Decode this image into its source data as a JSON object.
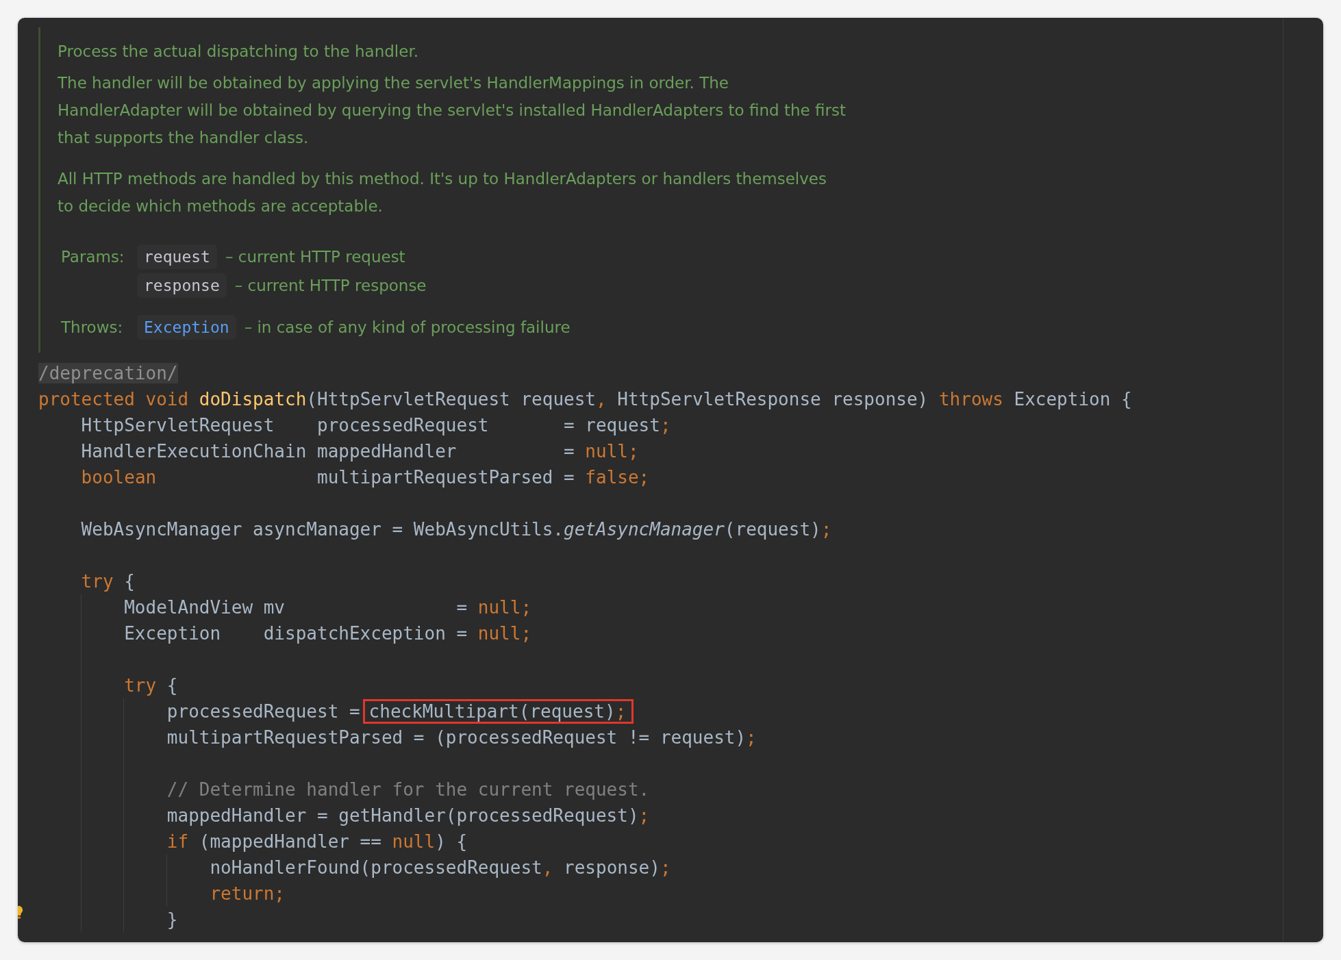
{
  "doc": {
    "paragraphs": [
      {
        "lines": [
          "Process the actual dispatching to the handler."
        ]
      },
      {
        "lines": [
          "The handler will be obtained by applying the servlet's HandlerMappings in order. The",
          "HandlerAdapter will be obtained by querying the servlet's installed HandlerAdapters to find the first",
          "that supports the handler class."
        ]
      },
      {
        "lines": [
          "All HTTP methods are handled by this method. It's up to HandlerAdapters or handlers themselves",
          "to decide which methods are acceptable."
        ]
      }
    ],
    "tags": [
      {
        "label": "Params:",
        "items": [
          {
            "name": "request",
            "description": "– current HTTP request",
            "kind": "param"
          },
          {
            "name": "response",
            "description": "– current HTTP response",
            "kind": "param"
          }
        ]
      },
      {
        "label": "Throws:",
        "items": [
          {
            "name": "Exception",
            "description": "– in case of any kind of processing failure",
            "kind": "link"
          }
        ]
      }
    ]
  },
  "code": [
    {
      "kind": "code",
      "tokens": [
        {
          "t": "/deprecation/",
          "kind": "annotation"
        }
      ]
    },
    {
      "kind": "code",
      "tokens": [
        {
          "t": "protected void ",
          "kind": "keyword"
        },
        {
          "t": "doDispatch",
          "kind": "method"
        },
        {
          "t": "(HttpServletRequest request",
          "kind": "plain"
        },
        {
          "t": ", ",
          "kind": "keyword"
        },
        {
          "t": "HttpServletResponse response) ",
          "kind": "plain"
        },
        {
          "t": "throws ",
          "kind": "keyword"
        },
        {
          "t": "Exception {",
          "kind": "plain"
        }
      ],
      "children": [
        {
          "kind": "code",
          "tokens": [
            {
              "t": "HttpServletRequest    processedRequest       = request",
              "kind": "plain"
            },
            {
              "t": ";",
              "kind": "keyword"
            }
          ]
        },
        {
          "kind": "code",
          "tokens": [
            {
              "t": "HandlerExecutionChain mappedHandler          = ",
              "kind": "plain"
            },
            {
              "t": "null;",
              "kind": "keyword"
            }
          ]
        },
        {
          "kind": "code",
          "tokens": [
            {
              "t": "boolean               ",
              "kind": "keyword"
            },
            {
              "t": "multipartRequestParsed = ",
              "kind": "plain"
            },
            {
              "t": "false;",
              "kind": "keyword"
            }
          ]
        },
        {
          "kind": "blank"
        },
        {
          "kind": "code",
          "tokens": [
            {
              "t": "WebAsyncManager asyncManager = WebAsyncUtils.",
              "kind": "plain"
            },
            {
              "t": "getAsyncManager",
              "kind": "italic"
            },
            {
              "t": "(request)",
              "kind": "plain"
            },
            {
              "t": ";",
              "kind": "keyword"
            }
          ]
        },
        {
          "kind": "blank"
        },
        {
          "kind": "code",
          "tokens": [
            {
              "t": "try ",
              "kind": "keyword"
            },
            {
              "t": "{",
              "kind": "plain"
            }
          ],
          "children": [
            {
              "kind": "code",
              "tokens": [
                {
                  "t": "ModelAndView mv                = ",
                  "kind": "plain"
                },
                {
                  "t": "null;",
                  "kind": "keyword"
                }
              ]
            },
            {
              "kind": "code",
              "tokens": [
                {
                  "t": "Exception    dispatchException = ",
                  "kind": "plain"
                },
                {
                  "t": "null;",
                  "kind": "keyword"
                }
              ]
            },
            {
              "kind": "blank"
            },
            {
              "kind": "code",
              "tokens": [
                {
                  "t": "try ",
                  "kind": "keyword"
                },
                {
                  "t": "{",
                  "kind": "plain"
                }
              ],
              "children": [
                {
                  "kind": "code",
                  "tokens": [
                    {
                      "t": "processedRequest =",
                      "kind": "plain"
                    },
                    {
                      "kind": "highlight",
                      "parts": [
                        {
                          "t": "checkMultipart(request)",
                          "kind": "plain"
                        },
                        {
                          "t": ";",
                          "kind": "keyword"
                        }
                      ]
                    }
                  ]
                },
                {
                  "kind": "code",
                  "tokens": [
                    {
                      "t": "multipartRequestParsed = (processedRequest != request)",
                      "kind": "plain"
                    },
                    {
                      "t": ";",
                      "kind": "keyword"
                    }
                  ]
                },
                {
                  "kind": "blank"
                },
                {
                  "kind": "code",
                  "tokens": [
                    {
                      "t": "// Determine handler for the current request.",
                      "kind": "comment"
                    }
                  ]
                },
                {
                  "kind": "code",
                  "tokens": [
                    {
                      "t": "mappedHandler = getHandler(processedRequest)",
                      "kind": "plain"
                    },
                    {
                      "t": ";",
                      "kind": "keyword"
                    }
                  ]
                },
                {
                  "kind": "code",
                  "tokens": [
                    {
                      "t": "if ",
                      "kind": "keyword"
                    },
                    {
                      "t": "(mappedHandler == ",
                      "kind": "plain"
                    },
                    {
                      "t": "null",
                      "kind": "keyword"
                    },
                    {
                      "t": ") {",
                      "kind": "plain"
                    }
                  ],
                  "children": [
                    {
                      "kind": "code",
                      "tokens": [
                        {
                          "t": "noHandlerFound(processedRequest",
                          "kind": "plain"
                        },
                        {
                          "t": ", ",
                          "kind": "keyword"
                        },
                        {
                          "t": "response)",
                          "kind": "plain"
                        },
                        {
                          "t": ";",
                          "kind": "keyword"
                        }
                      ]
                    },
                    {
                      "kind": "code",
                      "tokens": [
                        {
                          "t": "return;",
                          "kind": "keyword"
                        }
                      ]
                    }
                  ]
                },
                {
                  "kind": "code",
                  "tokens": [
                    {
                      "t": "}",
                      "kind": "plain"
                    }
                  ]
                }
              ]
            }
          ]
        }
      ]
    }
  ]
}
